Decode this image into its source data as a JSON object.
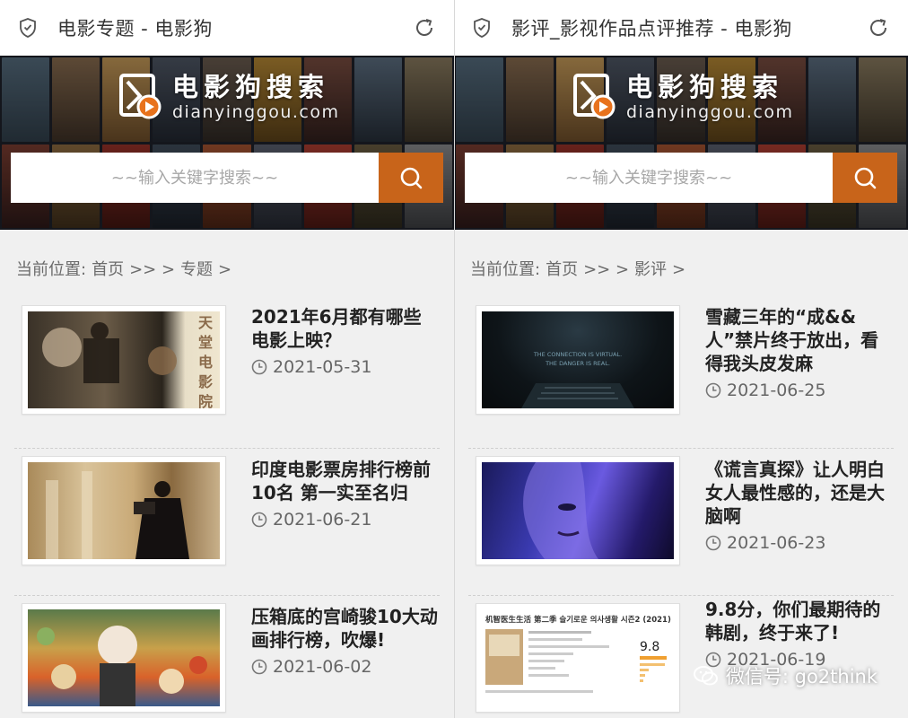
{
  "panels": [
    {
      "header": {
        "title": "电影专题 - 电影狗"
      },
      "logo": {
        "cn": "电影狗搜索",
        "en": "dianyinggou.com"
      },
      "search": {
        "placeholder": "~~输入关键字搜索~~"
      },
      "breadcrumb": {
        "prefix": "当前位置:",
        "home": "首页",
        "sep": ">> >",
        "current": "专题",
        "tail": ">"
      },
      "items": [
        {
          "title": "2021年6月都有哪些电影上映？",
          "date": "2021-05-31",
          "thumb": "projector"
        },
        {
          "title": "印度电影票房排行榜前10名 第一实至名归",
          "date": "2021-06-21",
          "thumb": "camera-woman"
        },
        {
          "title": "压箱底的宫崎骏10大动画排行榜，吹爆!",
          "date": "2021-06-02",
          "thumb": "miyazaki"
        }
      ]
    },
    {
      "header": {
        "title": "影评_影视作品点评推荐 - 电影狗"
      },
      "logo": {
        "cn": "电影狗搜索",
        "en": "dianyinggou.com"
      },
      "search": {
        "placeholder": "~~输入关键字搜索~~"
      },
      "breadcrumb": {
        "prefix": "当前位置:",
        "home": "首页",
        "sep": ">> >",
        "current": "影评",
        "tail": ">"
      },
      "items": [
        {
          "title": "雪藏三年的“成&&人”禁片终于放出，看得我头皮发麻",
          "date": "2021-06-25",
          "thumb": "keyboard",
          "caption_line1": "THE CONNECTION IS VIRTUAL.",
          "caption_line2": "THE DANGER IS REAL."
        },
        {
          "title": "《谎言真探》让人明白女人最性感的，还是大脑啊",
          "date": "2021-06-23",
          "thumb": "blue-face"
        },
        {
          "title": "9.8分，你们最期待的韩剧，终于来了!",
          "date": "2021-06-19",
          "thumb": "drama-card",
          "card_title": "机智医生生活 第二季 슬기로운 의사생활 시즌2 (2021)",
          "card_score": "9.8"
        }
      ]
    }
  ],
  "watermark": {
    "text": "微信号: go2think"
  },
  "colors": {
    "accent": "#c8641a",
    "text": "#222222",
    "muted": "#666666"
  }
}
